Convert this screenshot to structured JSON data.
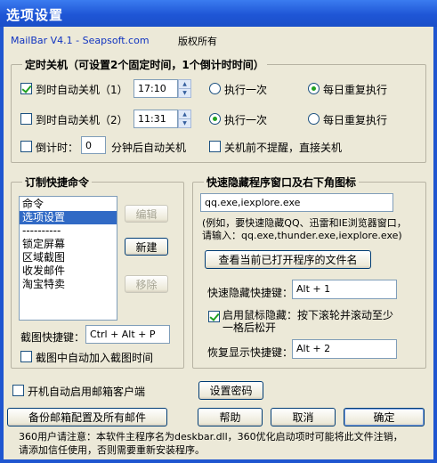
{
  "window": {
    "title": "选项设置"
  },
  "header": {
    "product": "MailBar V4.1 - Seapsoft.com",
    "copyright": "版权所有"
  },
  "shutdown": {
    "title": "定时关机（可设置2个固定时间，1个倒计时时间）",
    "timer1": {
      "label": "到时自动关机（1）",
      "checked": true,
      "time": "17:10",
      "once_label": "执行一次",
      "daily_label": "每日重复执行",
      "selected": "daily"
    },
    "timer2": {
      "label": "到时自动关机（2）",
      "checked": false,
      "time": "11:31",
      "once_label": "执行一次",
      "daily_label": "每日重复执行",
      "selected": "once"
    },
    "countdown": {
      "label": "倒计时：",
      "value": "0",
      "suffix": "分钟后自动关机",
      "checked": false
    },
    "no_prompt": {
      "label": "关机前不提醒，直接关机",
      "checked": false
    }
  },
  "quick_commands": {
    "title": "订制快捷命令",
    "items": [
      "命令",
      "选项设置",
      "----------",
      "锁定屏幕",
      "区域截图",
      "收发邮件",
      "淘宝特卖"
    ],
    "selected_index": 1,
    "edit_label": "编辑",
    "new_label": "新建",
    "remove_label": "移除",
    "screenshot_hotkey_label": "截图快捷键：",
    "screenshot_hotkey": "Ctrl + Alt + P",
    "add_time_label": "截图中自动加入截图时间",
    "add_time_checked": false
  },
  "hide_window": {
    "title": "快速隐藏程序窗口及右下角图标",
    "processes": "qq.exe,iexplore.exe",
    "hint_line1": "(例如，要快速隐藏QQ、迅雷和IE浏览器窗口，",
    "hint_line2": "请输入：qq.exe,thunder.exe,iexplore.exe)",
    "view_button": "查看当前已打开程序的文件名",
    "hide_hotkey_label": "快速隐藏快捷键：",
    "hide_hotkey": "Alt + 1",
    "mouse_hide_label_line1": "启用鼠标隐藏：按下滚轮并滚动至少",
    "mouse_hide_label_line2": "一格后松开",
    "mouse_hide_checked": true,
    "restore_hotkey_label": "恢复显示快捷键：",
    "restore_hotkey": "Alt + 2"
  },
  "bottom": {
    "autostart_label": "开机自动启用邮箱客户端",
    "autostart_checked": false,
    "set_password": "设置密码",
    "backup": "备份邮箱配置及所有邮件",
    "help": "帮助",
    "cancel": "取消",
    "ok": "确定",
    "notice_line1": "360用户请注意：本软件主程序名为deskbar.dll，360优化启动项时可能将此文件注销，",
    "notice_line2": "请添加信任使用，否则需要重新安装程序。"
  },
  "colors": {
    "title_bar": "#1f56d0",
    "dialog_bg": "#ece9d8",
    "selection": "#316ac5",
    "check": "#21a121"
  }
}
